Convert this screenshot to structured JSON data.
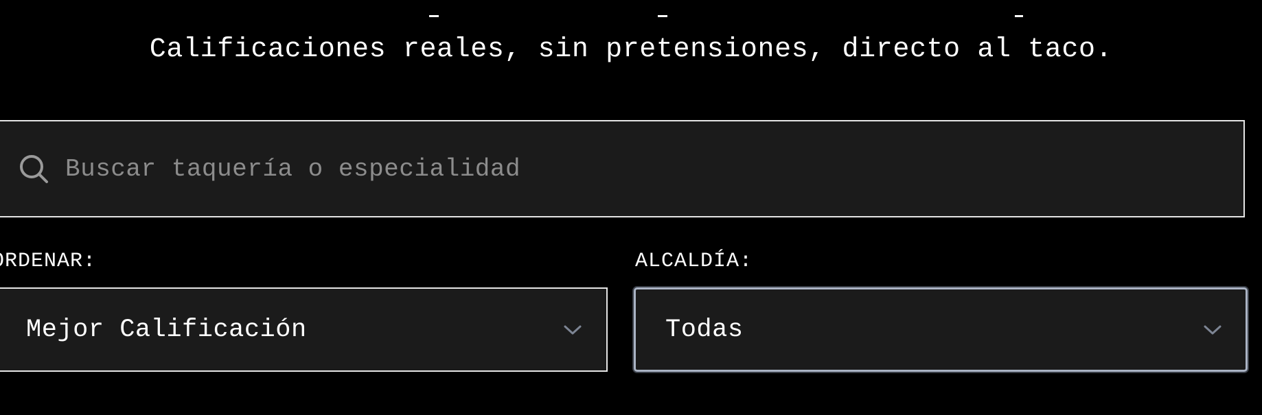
{
  "header": {
    "subtitle": "Calificaciones reales, sin pretensiones, directo al taco."
  },
  "search": {
    "placeholder": "Buscar taquería o especialidad",
    "value": "",
    "icon": "search-icon"
  },
  "filters": {
    "sort": {
      "label": "ORDENAR:",
      "selected": "Mejor Calificación",
      "icon": "chevron-down-icon"
    },
    "district": {
      "label": "ALCALDÍA:",
      "selected": "Todas",
      "icon": "chevron-down-icon"
    }
  },
  "colors": {
    "background": "#000000",
    "field_background": "#1b1b1b",
    "border": "#e6e6e6",
    "focus_border": "#aab3c4",
    "placeholder": "#8c8c8c",
    "text": "#ffffff"
  }
}
